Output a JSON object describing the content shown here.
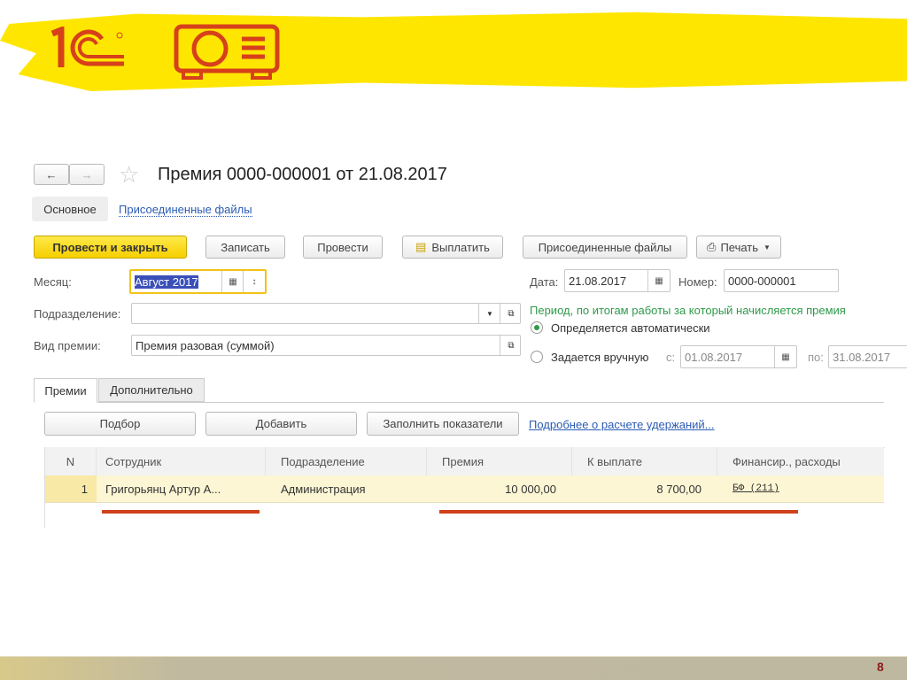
{
  "slide": {
    "page_number": "8",
    "colors": {
      "highlight": "#ffe600",
      "logo": "#d6401b",
      "footer": "#bfb8a0"
    },
    "logo_text": "1С"
  },
  "window": {
    "title": "Премия 0000-000001 от 21.08.2017",
    "nav_tabs": [
      "Основное",
      "Присоединенные файлы"
    ]
  },
  "toolbar": {
    "post_close": "Провести и закрыть",
    "save": "Записать",
    "post": "Провести",
    "pay": "Выплатить",
    "attached": "Присоединенные файлы",
    "print": "Печать"
  },
  "form": {
    "month_label": "Месяц:",
    "month_value": "Август 2017",
    "dept_label": "Подразделение:",
    "dept_value": "",
    "type_label": "Вид премии:",
    "type_value": "Премия разовая (суммой)",
    "date_label": "Дата:",
    "date_value": "21.08.2017",
    "number_label": "Номер:",
    "number_value": "0000-000001",
    "period_title": "Период, по итогам работы за который начисляется премия",
    "radio_auto": "Определяется автоматически",
    "radio_manual": "Задается вручную",
    "from_label": "с:",
    "from_value": "01.08.2017",
    "to_label": "по:",
    "to_value": "31.08.2017"
  },
  "tabs": [
    "Премии",
    "Дополнительно"
  ],
  "table_toolbar": {
    "select": "Подбор",
    "add": "Добавить",
    "fill": "Заполнить показатели",
    "details_link": "Подробнее о расчете удержаний..."
  },
  "table": {
    "headers": [
      "N",
      "Сотрудник",
      "Подразделение",
      "Премия",
      "К выплате",
      "Финансир., расходы"
    ],
    "rows": [
      [
        "1",
        "Григорьянц Артур А...",
        "Администрация",
        "10 000,00",
        "8 700,00",
        "БФ (211)"
      ]
    ]
  }
}
